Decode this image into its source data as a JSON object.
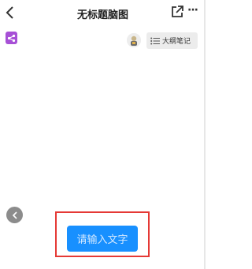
{
  "header": {
    "title": "无标题脑图",
    "back_icon": "chevron-left-icon",
    "share_icon": "external-link-icon",
    "more_label": "···"
  },
  "toolbar": {
    "logo_icon": "mindmap-logo-icon",
    "logo_color": "#a750d6",
    "avatar_icon": "user-avatar",
    "outline_icon": "list-icon",
    "outline_label": "大纲笔记"
  },
  "canvas": {
    "collapse_icon": "chevron-left-icon",
    "input_label": "请输入文字",
    "accent_color": "#1890ff",
    "highlight_color": "#e53935"
  }
}
